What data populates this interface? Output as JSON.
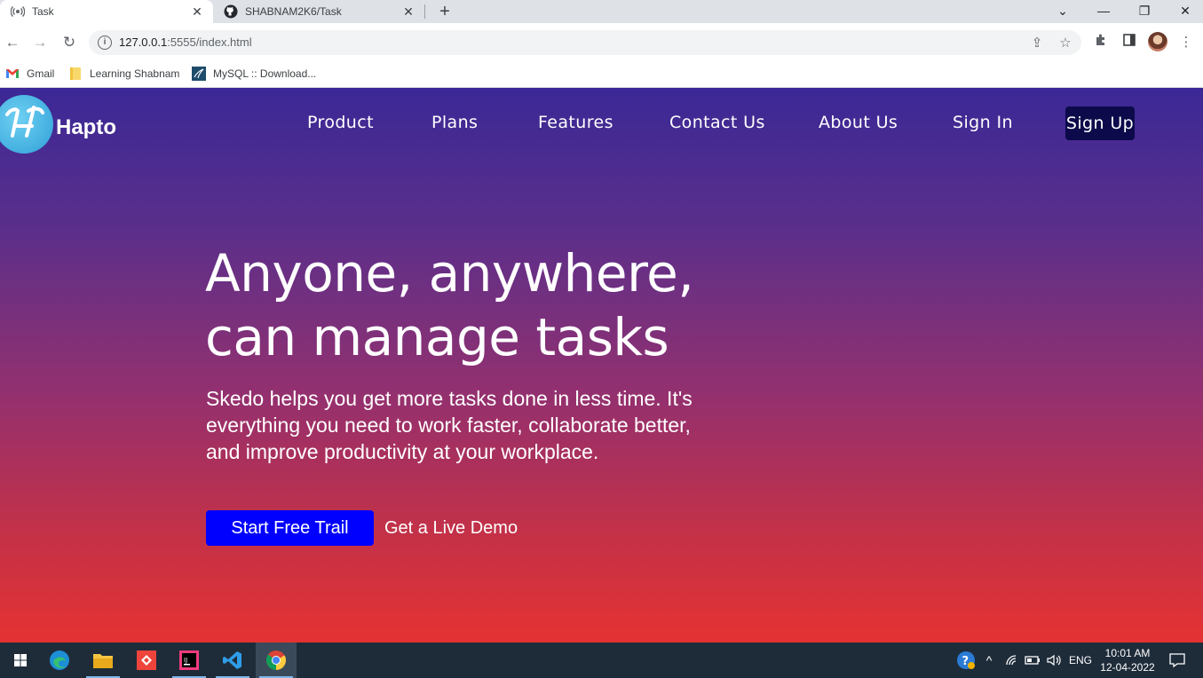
{
  "browser": {
    "tabs": [
      {
        "title": "Task",
        "icon": "broadcast-icon",
        "active": true
      },
      {
        "title": "SHABNAM2K6/Task",
        "icon": "github-icon",
        "active": false
      }
    ],
    "url_host": "127.0.0.1",
    "url_path": ":5555/index.html",
    "bookmarks": [
      {
        "label": "Gmail",
        "icon": "gmail-icon"
      },
      {
        "label": "Learning Shabnam",
        "icon": "folder-icon"
      },
      {
        "label": "MySQL :: Download...",
        "icon": "mysql-icon"
      }
    ]
  },
  "site": {
    "brand": "Hapto",
    "nav": [
      "Product",
      "Plans",
      "Features",
      "Contact Us",
      "About Us",
      "Sign In"
    ],
    "signup": "Sign Up",
    "hero": {
      "title_line1": "Anyone, anywhere,",
      "title_line2": "can manage tasks",
      "subtitle": "Skedo helps you get more tasks done in less time. It's everything you need to work faster, collaborate better, and improve productivity at your workplace.",
      "primary_cta": "Start Free Trail",
      "secondary_cta": "Get a Live Demo"
    },
    "colors": {
      "gradient_top": "#3b2896",
      "gradient_bottom": "#e53232",
      "cta_blue": "#0000ff",
      "signup_bg": "#0c0a4a"
    }
  },
  "taskbar": {
    "language": "ENG",
    "time": "10:01 AM",
    "date": "12-04-2022"
  }
}
